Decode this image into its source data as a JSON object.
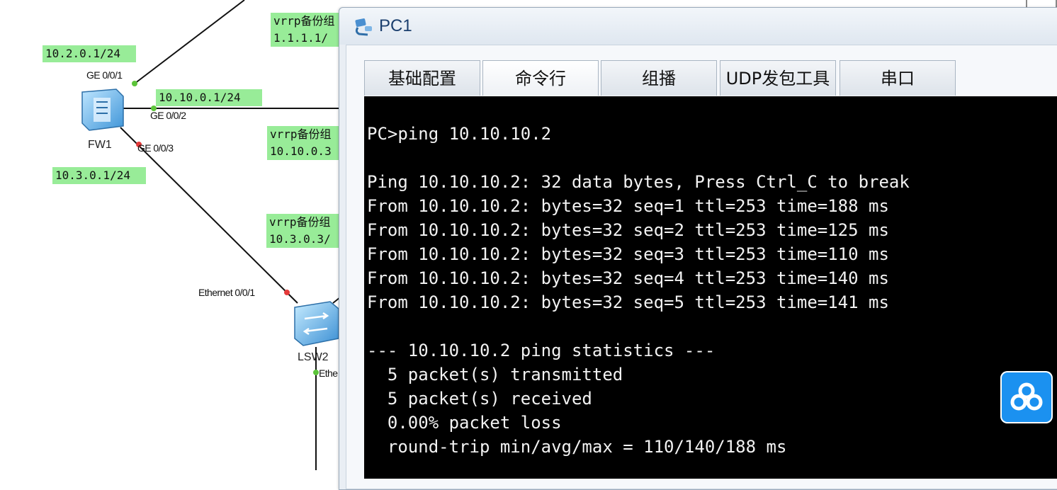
{
  "topology": {
    "labels": {
      "fw1_ge001_net": "10.2.0.1/24",
      "fw1_ge002_net": "10.10.0.1/24",
      "fw1_ge003_net": "10.3.0.1/24",
      "vrrp1_title": "vrrp备份组",
      "vrrp1_addr": "1.1.1.1/",
      "vrrp2_title": "vrrp备份组",
      "vrrp2_addr": "10.10.0.3",
      "vrrp3_title": "vrrp备份组",
      "vrrp3_addr": "10.3.0.3/"
    },
    "ports": {
      "ge001": "GE 0/0/1",
      "ge002": "GE 0/0/2",
      "ge003": "GE 0/0/3",
      "eth001": "Ethernet 0/0/1",
      "eth_lsw2_bottom": "Ethe"
    },
    "devices": {
      "fw1": "FW1",
      "lsw2": "LSW2"
    }
  },
  "window": {
    "title": "PC1",
    "tabs": [
      "基础配置",
      "命令行",
      "组播",
      "UDP发包工具",
      "串口"
    ],
    "active_tab": "命令行"
  },
  "console_lines": [
    "PC>ping 10.10.10.2",
    "",
    "Ping 10.10.10.2: 32 data bytes, Press Ctrl_C to break",
    "From 10.10.10.2: bytes=32 seq=1 ttl=253 time=188 ms",
    "From 10.10.10.2: bytes=32 seq=2 ttl=253 time=125 ms",
    "From 10.10.10.2: bytes=32 seq=3 ttl=253 time=110 ms",
    "From 10.10.10.2: bytes=32 seq=4 ttl=253 time=140 ms",
    "From 10.10.10.2: bytes=32 seq=5 ttl=253 time=141 ms",
    "",
    "--- 10.10.10.2 ping statistics ---",
    "  5 packet(s) transmitted",
    "  5 packet(s) received",
    "  0.00% packet loss",
    "  round-trip min/avg/max = 110/140/188 ms"
  ],
  "colors": {
    "net_label_bg": "#98ec98",
    "console_bg": "#000000",
    "console_fg": "#f2f2f2",
    "port_up": "#5cc43a",
    "port_down": "#e53a3a",
    "cloud_button": "#1b91f0"
  }
}
